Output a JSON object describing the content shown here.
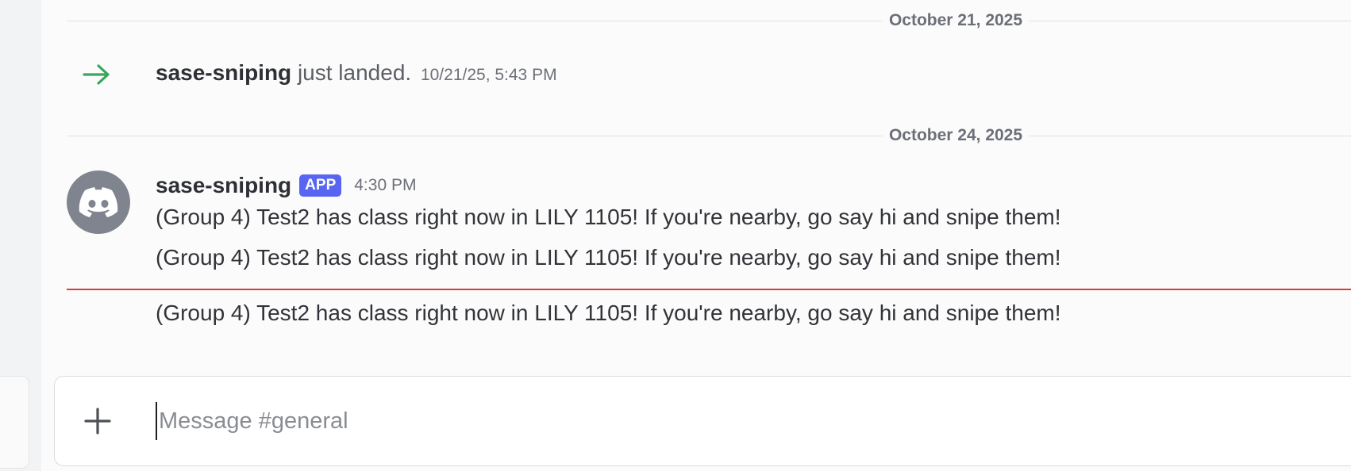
{
  "dividers": [
    {
      "date": "October 21, 2025"
    },
    {
      "date": "October 24, 2025"
    }
  ],
  "system_message": {
    "username": "sase-sniping",
    "text": "just landed.",
    "timestamp": "10/21/25, 5:43 PM",
    "icon": "arrow-right-icon",
    "icon_color": "#3ba55c"
  },
  "message_group": {
    "username": "sase-sniping",
    "badge": "APP",
    "badge_color": "#5865f2",
    "timestamp": "4:30 PM",
    "avatar_icon": "discord-logo-icon",
    "avatar_color": "#80848e",
    "messages": [
      "(Group 4) Test2 has class right now in LILY 1105! If you're nearby, go say hi and snipe them!",
      "(Group 4) Test2 has class right now in LILY 1105! If you're nearby, go say hi and snipe them!",
      "(Group 4) Test2 has class right now in LILY 1105! If you're nearby, go say hi and snipe them!"
    ]
  },
  "new_messages_divider_color": "#d83c3e",
  "composer": {
    "placeholder": "Message #general",
    "value": "",
    "attach_icon": "plus-icon"
  }
}
